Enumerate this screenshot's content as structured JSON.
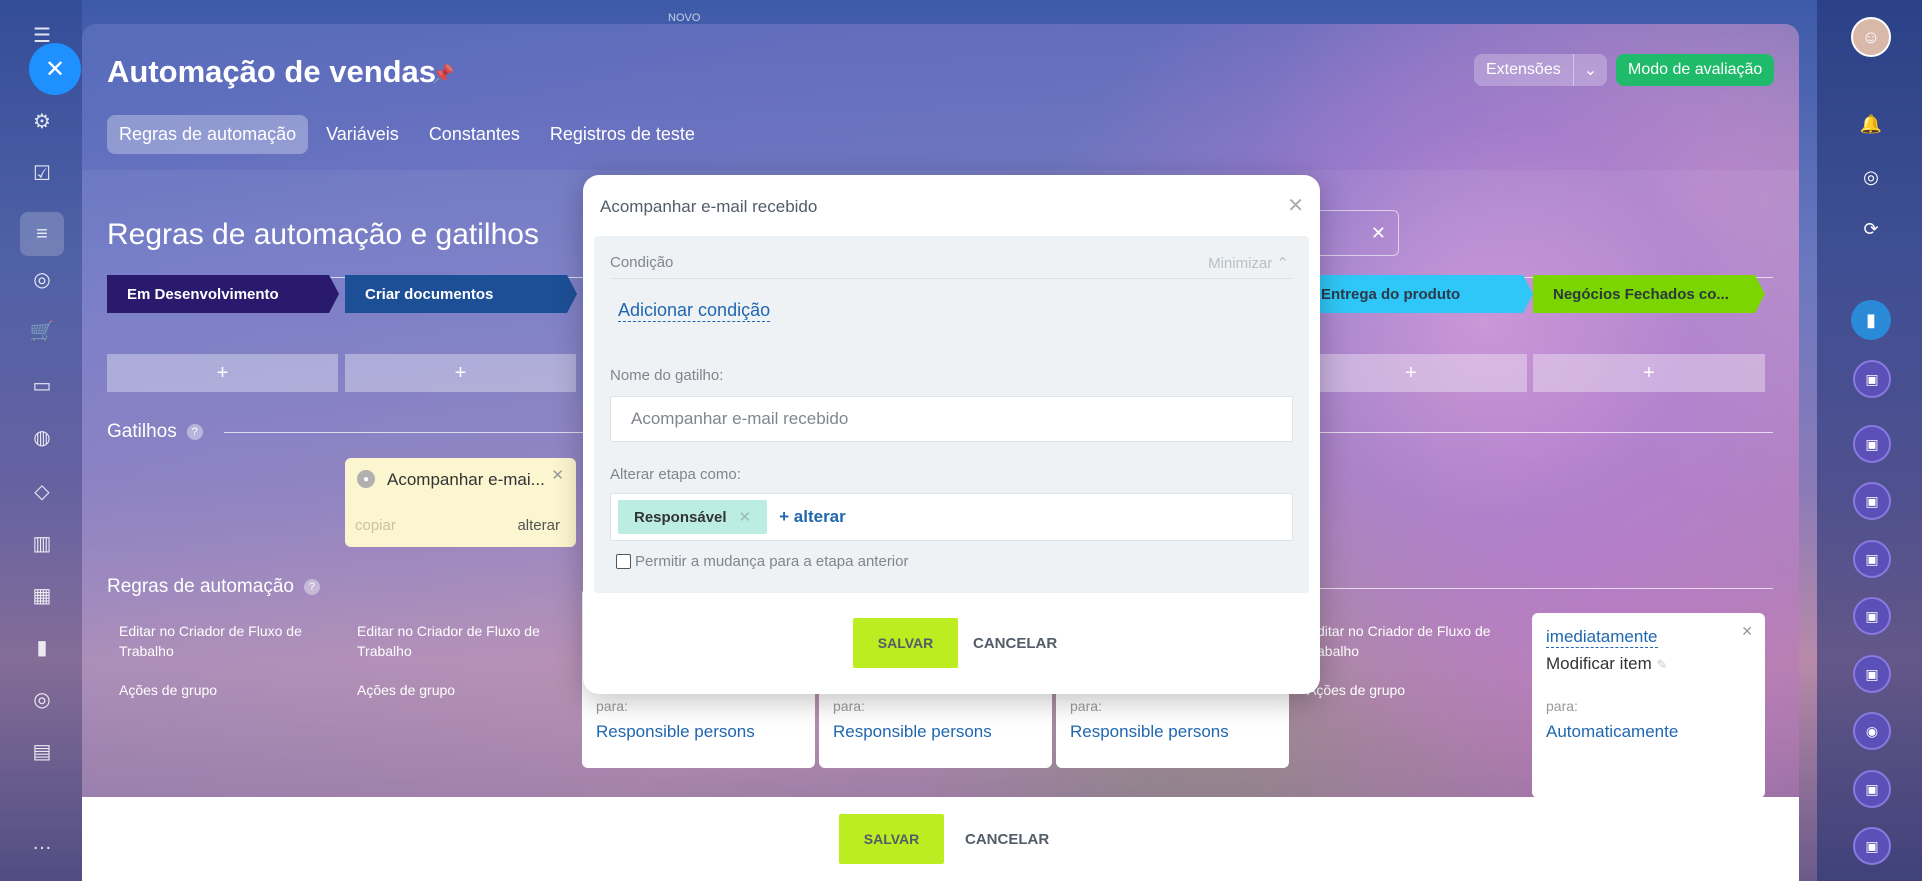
{
  "top_label": "NOVO",
  "page": {
    "title": "Automação de vendas",
    "tabs": [
      "Regras de automação",
      "Variáveis",
      "Constantes",
      "Registros de teste"
    ],
    "extensions_label": "Extensões",
    "eval_mode_label": "Modo de avaliação"
  },
  "section_title": "Regras de automação e gatilhos",
  "stages": [
    {
      "label": "Em Desenvolvimento",
      "color": "#2a1a6e"
    },
    {
      "label": "Criar documentos",
      "color": "#1d4f97"
    },
    {
      "label": "Entrega do produto",
      "color": "#2fc7f7"
    },
    {
      "label": "Negócios Fechados co...",
      "color": "#7bd500"
    }
  ],
  "plus_label": "+",
  "triggers": {
    "title": "Gatilhos",
    "help": "?",
    "card": {
      "label": "Acompanhar e-mai...",
      "copy": "copiar",
      "change": "alterar"
    }
  },
  "rules": {
    "title": "Regras de automação",
    "help": "?",
    "edit_label": "Editar no Criador de Fluxo de Trabalho",
    "group_label": "Ações de grupo",
    "edit_label_partial": "ditar no Criador de Fluxo de",
    "edit_label_partial2": "abalho",
    "group_label_partial": "Ações de grupo",
    "for_label": "para:",
    "responsible": "Responsible persons",
    "last_card": {
      "timing": "imediatamente",
      "action": "Modificar item",
      "target": "Automaticamente"
    }
  },
  "bottom": {
    "save": "SALVAR",
    "cancel": "CANCELAR"
  },
  "modal": {
    "title": "Acompanhar e-mail recebido",
    "condition_label": "Condição",
    "minimize_label": "Minimizar",
    "add_condition": "Adicionar condição",
    "trigger_name_label": "Nome do gatilho:",
    "trigger_name_value": "Acompanhar e-mail recebido",
    "change_stage_label": "Alterar etapa como:",
    "tag": "Responsável",
    "change_link": "+ alterar",
    "allow_prev": "Permitir a mudança para a etapa anterior",
    "save": "SALVAR",
    "cancel": "CANCELAR"
  }
}
